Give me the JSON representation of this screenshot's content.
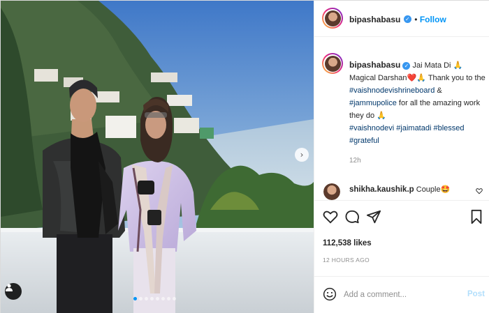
{
  "post": {
    "username": "bipashabasu",
    "follow_label": "Follow",
    "more_label": "•••",
    "caption_lines": {
      "line1_text": "Jai Mata Di",
      "line1_emoji": "🙏",
      "line2_text": "Magical Darshan",
      "line2_emoji": "❤️🙏",
      "line2_rest": "Thank you to the",
      "hash1": "#vaishnodevishrineboard",
      "line3_rest": " &",
      "hash2": "#jammupolice",
      "line4_rest": " for all the amazing work",
      "line5_text": "they do",
      "line5_emoji": "🙏",
      "hash3": "#vaishnodevi",
      "hash4": "#jaimatadi",
      "hash5": "#blessed",
      "hash6": "#grateful"
    },
    "caption_time": "12h",
    "comment": {
      "username": "shikha.kaushik.p",
      "text": "Couple",
      "emoji": "🤩"
    },
    "likes": "112,538 likes",
    "posted_ago": "12 HOURS AGO",
    "add_comment_placeholder": "Add a comment...",
    "post_label": "Post"
  },
  "media": {
    "next_arrow": "›",
    "carousel_dots": 8,
    "active_dot": 0
  },
  "colors": {
    "accent": "#0095f6",
    "verified": "#3897f0",
    "hashtag": "#00376b",
    "muted": "#8e8e8e"
  },
  "icons": [
    "tag-person-icon",
    "chevron-right-icon",
    "verified-icon",
    "more-icon",
    "heart-icon",
    "comment-icon",
    "share-icon",
    "bookmark-icon",
    "emoji-icon"
  ]
}
